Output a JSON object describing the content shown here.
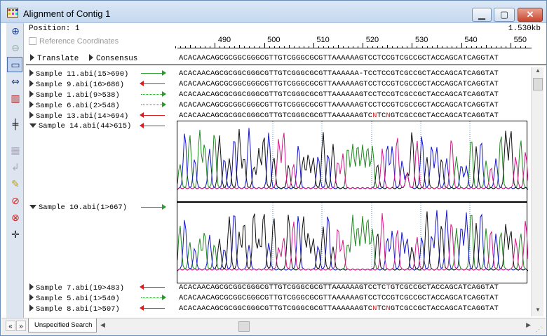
{
  "window": {
    "title": "Alignment of Contig 1"
  },
  "header": {
    "position_label": "Position: 1",
    "length_label": "1.530kb",
    "reference_coordinates_label": "Reference Coordinates",
    "ruler": [
      "490",
      "500",
      "510",
      "520",
      "530",
      "540",
      "550"
    ]
  },
  "consensus": {
    "translate_label": "Translate",
    "consensus_label": "Consensus",
    "sequence": "ACACAACAGCGCGGCGGGCGTTGTCGGGCGCGTTAAAAAAGTCCTCCGTCGCCGCTACCAGCATCAGGTAT"
  },
  "samples": [
    {
      "label": "Sample 11.abi(15>690)",
      "direction": "forward",
      "style": "solid",
      "sequence": "ACACAACAGCGCGGCGGGCGTTGTCGGGCGCGTTAAAAAA-TCCTCCGTCGCCGCTACCAGCATCAGGTAT"
    },
    {
      "label": "Sample 9.abi(16>686)",
      "direction": "reverse",
      "style": "solid",
      "sequence": "ACACAACAGCGCGGCGGGCGTTGTCGGGCGCGTTAAAAAAGTCCTCCGTCGCCGCTACCAGCATCAGGTAT"
    },
    {
      "label": "Sample 1.abi(9>538)",
      "direction": "forward",
      "style": "dotted",
      "sequence": "ACACAACAGCGCGGCGGGCGTTGTCGGGCGCGTTAAAAAAGTCCTCCGTCGCCGCTACCAGCATCAGGTAT"
    },
    {
      "label": "Sample 6.abi(2>548)",
      "direction": "forward",
      "style": "dotted",
      "sequence": "ACACAACAGCGCGGCGGGCGTTGTCGGGCGCGTTAAAAAAGTCCTCCGTCGCCGCTACCAGCATCAGGTAT"
    },
    {
      "label": "Sample 13.abi(14>694)",
      "direction": "reverse",
      "style": "solid",
      "sequence": "ACACAACAGCGCGGCGGGCGTTGTCGGGCGCGTTAAAAAAGTCNTCNGTCGCCGCTACCAGCATCAGGTAT"
    },
    {
      "label": "Sample 14.abi(44>615)",
      "direction": "reverse",
      "style": "solid",
      "sequence": "ACACAACAGCGCGGCGGGCGTTGTCGGGCGCGTTAAAAAAGTCCTCNGTCGCCGCTACCAGCATCAGGTAT",
      "expanded": true
    },
    {
      "label": "Sample 10.abi(1>667)",
      "direction": "forward",
      "style": "solid",
      "sequence": "ACACAACAGCGCGGCGGGCGTTGTCGGGCGCGTTAAAAAAGTCCTCCGTCGCCGCTACCAGCATCAGGTAT",
      "expanded": true
    },
    {
      "label": "Sample 7.abi(19>483)",
      "direction": "reverse",
      "style": "solid",
      "sequence": "ACACAACAGCGCGGCGGGCGTTGTCGGGCGCGTTAAAAAAGTCCTCTGTCGCCGCTACCAGCATCAGGTAT"
    },
    {
      "label": "Sample 5.abi(1>540)",
      "direction": "forward",
      "style": "dotted",
      "sequence": "ACACAACAGCGCGGCGGGCGTTGTCGGGCGCGTTAAAAAAGTCCTCCGTCGCCGCTACCAGCATCAGGTAT"
    },
    {
      "label": "Sample 8.abi(1>507)",
      "direction": "reverse",
      "style": "solid",
      "sequence": "ACACAACAGCGCGGCGGGCGTTGTCGGGCGCGTTAAAAAAGTCNTCNGTCGCCGCTACCAGCATCAGGTAT"
    }
  ],
  "bottom": {
    "tab_label": "Unspecified Search",
    "nav_prev": "«",
    "nav_next": "»"
  },
  "colors": {
    "forward_arrow": "#2a9a2a",
    "reverse_arrow": "#d42020",
    "trace_A": "#1f8a1f",
    "trace_C": "#1515c8",
    "trace_G": "#111111",
    "trace_T": "#d2188a",
    "mismatch": "#d42020"
  },
  "toolbar": [
    "zoom-in-icon",
    "zoom-out-icon",
    "select-region-icon",
    "fit-width-icon",
    "color-bars-icon",
    "slider-icon",
    "pattern-icon",
    "arrow-icon",
    "highlighter-icon",
    "no-entry-icon",
    "no-pencil-icon",
    "cursor-cross-icon"
  ]
}
